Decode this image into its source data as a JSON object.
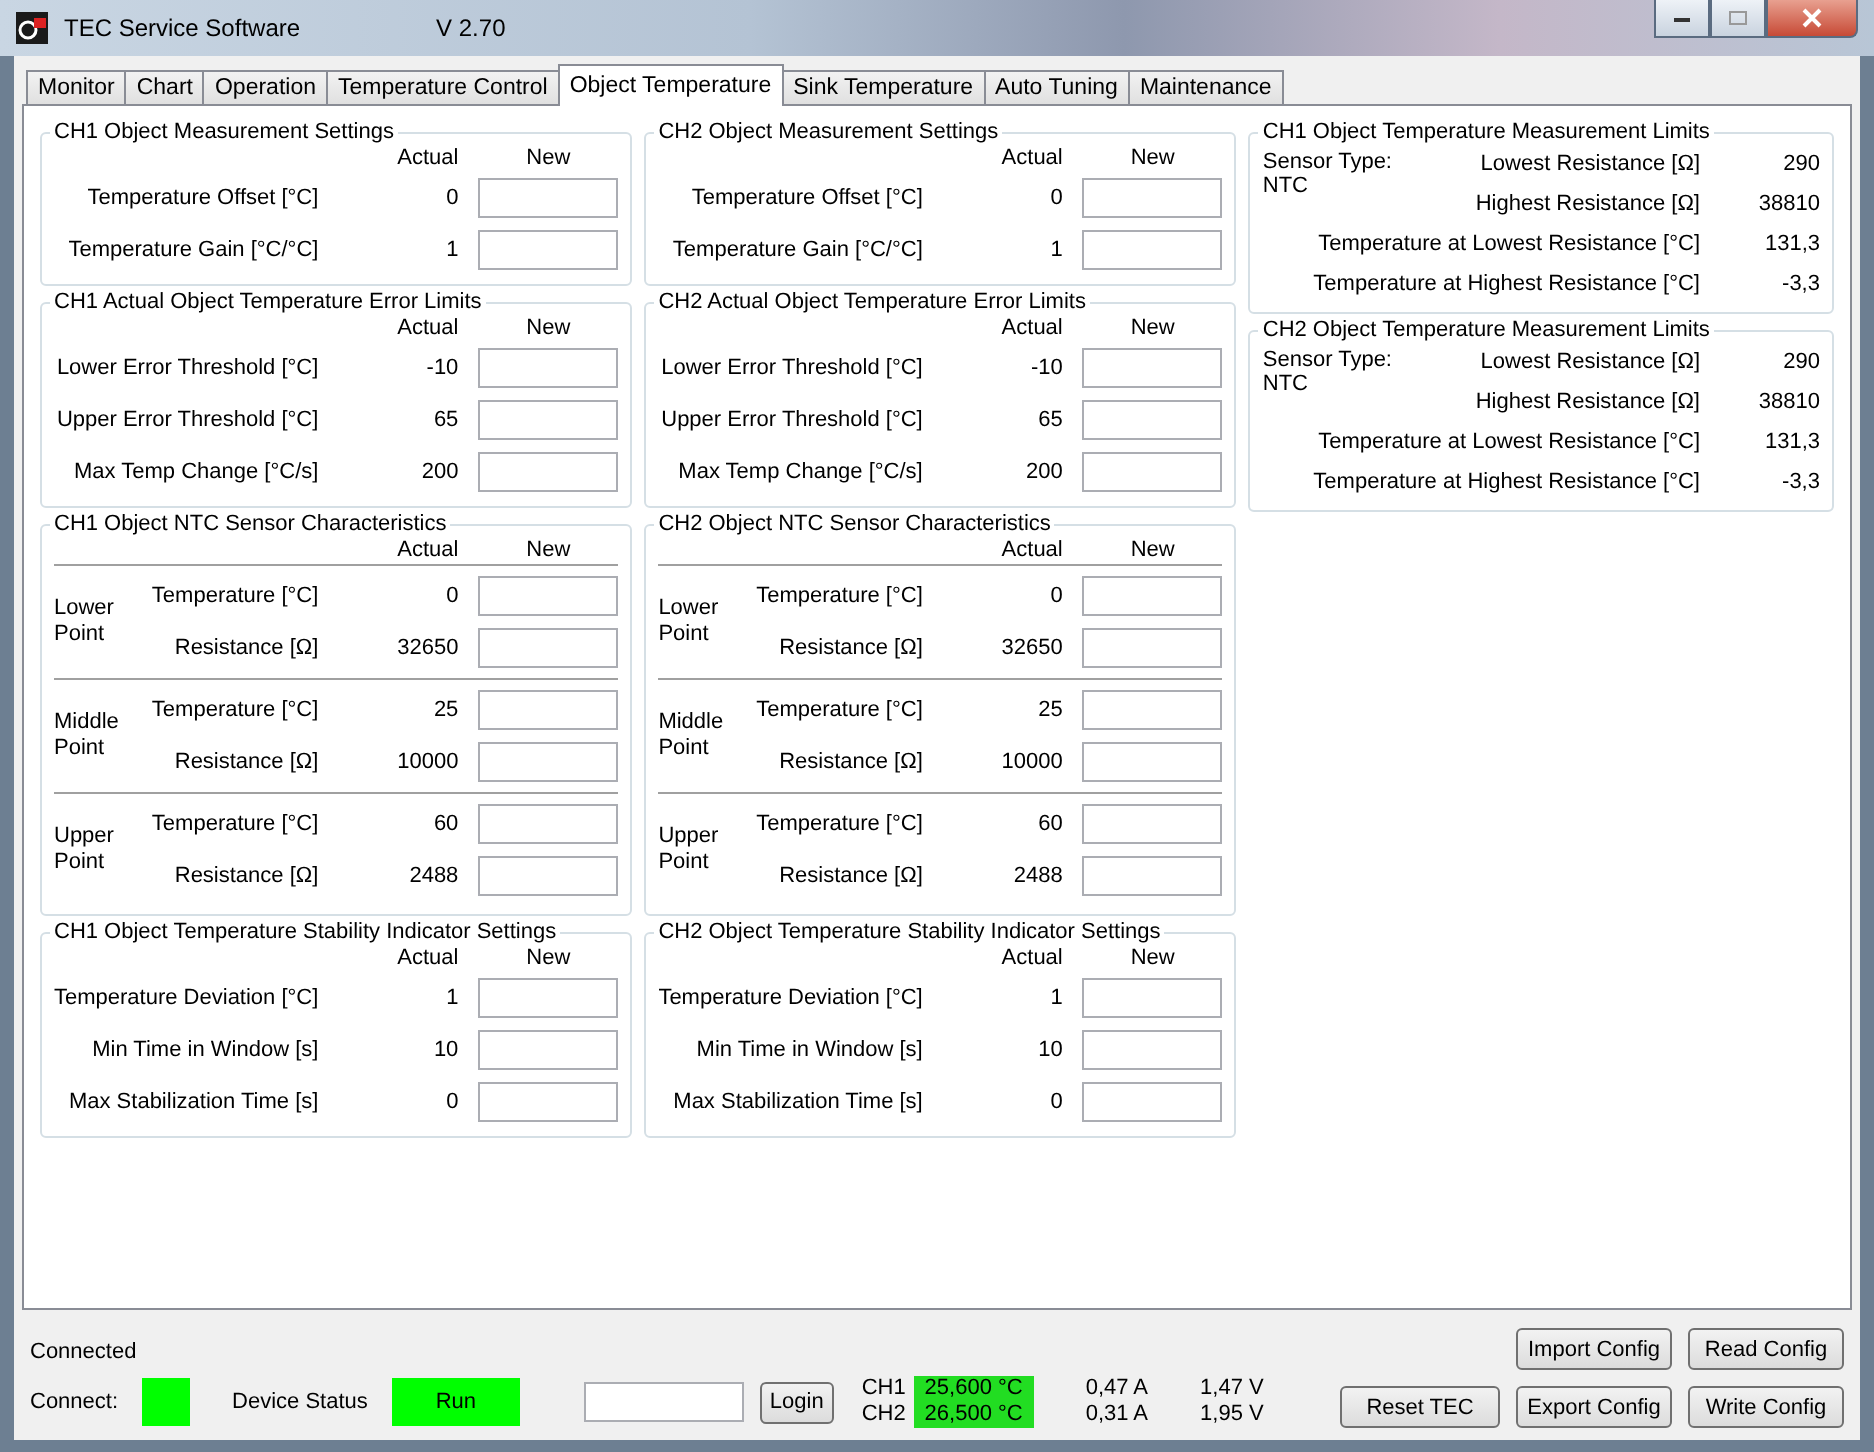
{
  "window": {
    "title": "TEC Service Software",
    "version": "V 2.70"
  },
  "tabs": [
    {
      "label": "Monitor",
      "selected": false
    },
    {
      "label": "Chart",
      "selected": false
    },
    {
      "label": "Operation",
      "selected": false
    },
    {
      "label": "Temperature Control",
      "selected": false
    },
    {
      "label": "Object Temperature",
      "selected": true
    },
    {
      "label": "Sink Temperature",
      "selected": false
    },
    {
      "label": "Auto Tuning",
      "selected": false
    },
    {
      "label": "Maintenance",
      "selected": false
    }
  ],
  "columns": [
    [
      {
        "kind": "settings",
        "title": "CH1 Object Measurement Settings",
        "actual_header": "Actual",
        "new_header": "New",
        "rows": [
          {
            "label": "Temperature Offset [°C]",
            "actual": "0"
          },
          {
            "label": "Temperature Gain [°C/°C]",
            "actual": "1"
          }
        ]
      },
      {
        "kind": "settings",
        "title": "CH1 Actual Object Temperature Error Limits",
        "actual_header": "Actual",
        "new_header": "New",
        "rows": [
          {
            "label": "Lower Error Threshold [°C]",
            "actual": "-10"
          },
          {
            "label": "Upper Error Threshold [°C]",
            "actual": "65"
          },
          {
            "label": "Max Temp Change [°C/s]",
            "actual": "200"
          }
        ]
      },
      {
        "kind": "ntc",
        "title": "CH1 Object NTC Sensor Characteristics",
        "actual_header": "Actual",
        "new_header": "New",
        "points": [
          {
            "name": "Lower Point",
            "rows": [
              {
                "label": "Temperature [°C]",
                "actual": "0"
              },
              {
                "label": "Resistance [Ω]",
                "actual": "32650"
              }
            ]
          },
          {
            "name": "Middle Point",
            "rows": [
              {
                "label": "Temperature [°C]",
                "actual": "25"
              },
              {
                "label": "Resistance [Ω]",
                "actual": "10000"
              }
            ]
          },
          {
            "name": "Upper Point",
            "rows": [
              {
                "label": "Temperature [°C]",
                "actual": "60"
              },
              {
                "label": "Resistance [Ω]",
                "actual": "2488"
              }
            ]
          }
        ]
      },
      {
        "kind": "settings",
        "title": "CH1 Object Temperature Stability Indicator Settings",
        "actual_header": "Actual",
        "new_header": "New",
        "rows": [
          {
            "label": "Temperature Deviation [°C]",
            "actual": "1"
          },
          {
            "label": "Min Time in Window [s]",
            "actual": "10"
          },
          {
            "label": "Max Stabilization Time [s]",
            "actual": "0"
          }
        ]
      }
    ],
    [
      {
        "kind": "settings",
        "title": "CH2 Object Measurement Settings",
        "actual_header": "Actual",
        "new_header": "New",
        "rows": [
          {
            "label": "Temperature Offset [°C]",
            "actual": "0"
          },
          {
            "label": "Temperature Gain [°C/°C]",
            "actual": "1"
          }
        ]
      },
      {
        "kind": "settings",
        "title": "CH2 Actual Object Temperature Error Limits",
        "actual_header": "Actual",
        "new_header": "New",
        "rows": [
          {
            "label": "Lower Error Threshold [°C]",
            "actual": "-10"
          },
          {
            "label": "Upper Error Threshold [°C]",
            "actual": "65"
          },
          {
            "label": "Max Temp Change [°C/s]",
            "actual": "200"
          }
        ]
      },
      {
        "kind": "ntc",
        "title": "CH2 Object NTC Sensor Characteristics",
        "actual_header": "Actual",
        "new_header": "New",
        "points": [
          {
            "name": "Lower Point",
            "rows": [
              {
                "label": "Temperature [°C]",
                "actual": "0"
              },
              {
                "label": "Resistance [Ω]",
                "actual": "32650"
              }
            ]
          },
          {
            "name": "Middle Point",
            "rows": [
              {
                "label": "Temperature [°C]",
                "actual": "25"
              },
              {
                "label": "Resistance [Ω]",
                "actual": "10000"
              }
            ]
          },
          {
            "name": "Upper Point",
            "rows": [
              {
                "label": "Temperature [°C]",
                "actual": "60"
              },
              {
                "label": "Resistance [Ω]",
                "actual": "2488"
              }
            ]
          }
        ]
      },
      {
        "kind": "settings",
        "title": "CH2 Object Temperature Stability Indicator Settings",
        "actual_header": "Actual",
        "new_header": "New",
        "rows": [
          {
            "label": "Temperature Deviation [°C]",
            "actual": "1"
          },
          {
            "label": "Min Time in Window [s]",
            "actual": "10"
          },
          {
            "label": "Max Stabilization Time [s]",
            "actual": "0"
          }
        ]
      }
    ],
    [
      {
        "kind": "limits",
        "title": "CH1 Object Temperature Measurement Limits",
        "sensor_label": "Sensor Type:",
        "sensor_type": "NTC",
        "rows": [
          {
            "label": "Lowest Resistance [Ω]",
            "value": "290"
          },
          {
            "label": "Highest Resistance [Ω]",
            "value": "38810"
          },
          {
            "label": "Temperature at Lowest Resistance [°C]",
            "value": "131,3"
          },
          {
            "label": "Temperature at Highest Resistance [°C]",
            "value": "-3,3"
          }
        ]
      },
      {
        "kind": "limits",
        "title": "CH2 Object Temperature Measurement Limits",
        "sensor_label": "Sensor Type:",
        "sensor_type": "NTC",
        "rows": [
          {
            "label": "Lowest Resistance [Ω]",
            "value": "290"
          },
          {
            "label": "Highest Resistance [Ω]",
            "value": "38810"
          },
          {
            "label": "Temperature at Lowest Resistance [°C]",
            "value": "131,3"
          },
          {
            "label": "Temperature at Highest Resistance [°C]",
            "value": "-3,3"
          }
        ]
      }
    ]
  ],
  "status_bar": {
    "connection_text": "Connected",
    "connect_label": "Connect:",
    "connected": true,
    "device_status_label": "Device Status",
    "device_status": "Run",
    "device_ok": true,
    "login_button": "Login",
    "channels": [
      {
        "name": "CH1",
        "temperature": "25,600 °C",
        "in_range": true,
        "current": "0,47 A",
        "voltage": "1,47 V"
      },
      {
        "name": "CH2",
        "temperature": "26,500 °C",
        "in_range": true,
        "current": "0,31 A",
        "voltage": "1,95 V"
      }
    ],
    "buttons": {
      "import": "Import Config",
      "read": "Read Config",
      "reset": "Reset TEC",
      "export": "Export Config",
      "write": "Write Config"
    }
  }
}
